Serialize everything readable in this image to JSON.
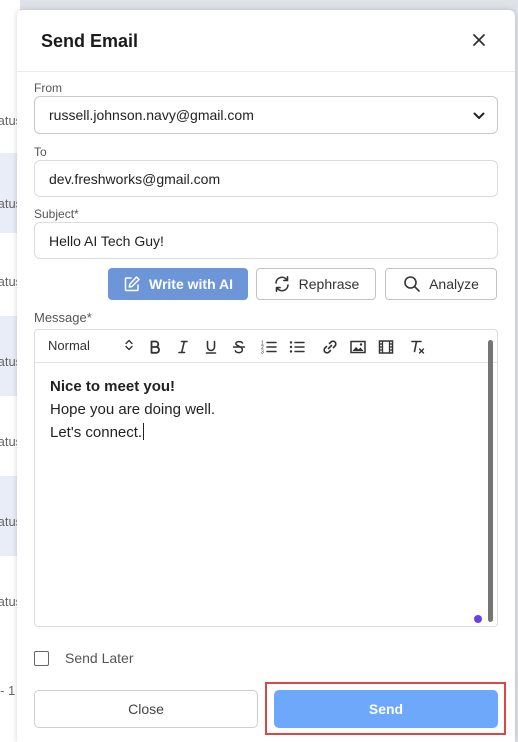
{
  "background": {
    "rows": [
      {
        "text": "tatus",
        "tinted": false
      },
      {
        "text": "tatus",
        "tinted": true
      },
      {
        "text": "tatus",
        "tinted": false
      },
      {
        "text": "tatus",
        "tinted": true
      },
      {
        "text": "tatus",
        "tinted": false
      },
      {
        "text": "tatus",
        "tinted": true
      },
      {
        "text": "tatus",
        "tinted": false
      }
    ],
    "footer_text": "- 1"
  },
  "dialog": {
    "title": "Send Email",
    "close_icon": "close-icon"
  },
  "from": {
    "label": "From",
    "value": "russell.johnson.navy@gmail.com"
  },
  "to": {
    "label": "To",
    "value": "dev.freshworks@gmail.com"
  },
  "subject": {
    "label": "Subject*",
    "value": "Hello AI Tech Guy!"
  },
  "ai_actions": {
    "write": "Write with AI",
    "rephrase": "Rephrase",
    "analyze": "Analyze"
  },
  "message": {
    "label": "Message*",
    "format": "Normal",
    "toolbar": [
      "bold",
      "italic",
      "underline",
      "strikethrough",
      "ordered-list",
      "bullet-list",
      "link",
      "image",
      "video",
      "clear-format"
    ],
    "lines": [
      "Nice to meet you!",
      "Hope you are doing well.",
      "Let's connect."
    ]
  },
  "send_later": {
    "label": "Send Later",
    "checked": false
  },
  "buttons": {
    "close": "Close",
    "send": "Send"
  },
  "colors": {
    "write_ai_button": "#6d96d9",
    "send_button": "#6ea8fb",
    "highlight_frame": "#d94747"
  }
}
